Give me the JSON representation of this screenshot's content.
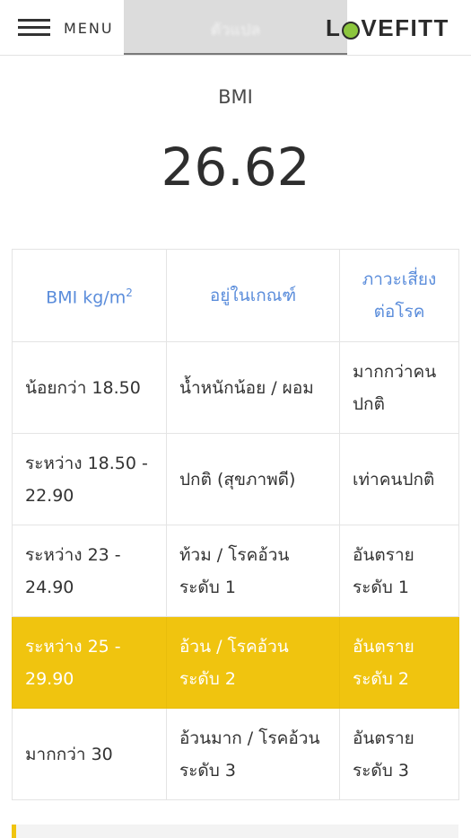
{
  "header": {
    "menu_label": "MENU",
    "tab_label": "ตัวแปล",
    "logo_text_left": "L",
    "logo_text_right": "VEFITT"
  },
  "result": {
    "label": "BMI",
    "value": "26.62"
  },
  "table": {
    "headers": [
      "BMI kg/m",
      "อยู่ในเกณฑ์",
      "ภาวะเสี่ยงต่อโรค"
    ],
    "header_unit_sup": "2",
    "rows": [
      [
        "น้อยกว่า 18.50",
        "น้ำหนักน้อย / ผอม",
        "มากกว่าคนปกติ"
      ],
      [
        "ระหว่าง 18.50 - 22.90",
        "ปกติ (สุขภาพดี)",
        "เท่าคนปกติ"
      ],
      [
        "ระหว่าง 23 - 24.90",
        "ท้วม / โรคอ้วนระดับ 1",
        "อันตรายระดับ 1"
      ],
      [
        "ระหว่าง 25 - 29.90",
        "อ้วน / โรคอ้วนระดับ 2",
        "อันตรายระดับ 2"
      ],
      [
        "มากกว่า 30",
        "อ้วนมาก / โรคอ้วนระดับ 3",
        "อันตรายระดับ 3"
      ]
    ],
    "highlight_row_index": 3
  },
  "colors": {
    "highlight": "#f0c40f",
    "header_text": "#5b8ddb",
    "logo_accent": "#8cc63e"
  },
  "icons": [
    "hamburger-menu-icon",
    "lovefitt-logo-icon"
  ]
}
